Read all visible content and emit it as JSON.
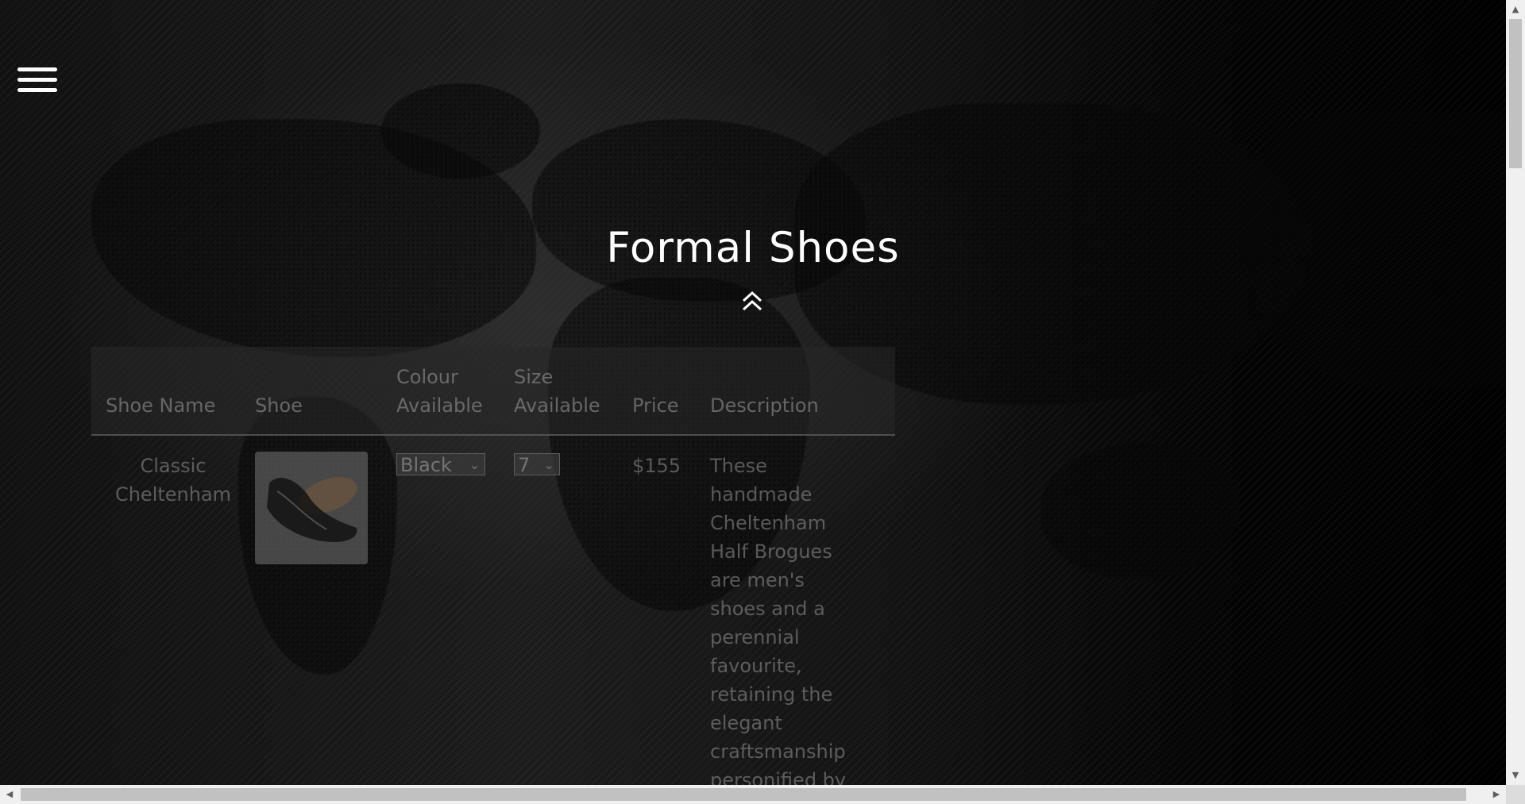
{
  "nav": {
    "menu_icon": "hamburger-menu-icon"
  },
  "header": {
    "title": "Formal Shoes",
    "scroll_up_icon": "double-chevron-up-icon"
  },
  "table": {
    "columns": [
      "Shoe Name",
      "Shoe",
      "Colour Available",
      "Size Available",
      "Price",
      "Description"
    ],
    "column_lines": {
      "colour": [
        "Colour",
        "Available"
      ],
      "size": [
        "Size",
        "Available"
      ]
    },
    "rows": [
      {
        "name_lines": [
          "Classic",
          "Cheltenham"
        ],
        "image_icon": "shoe-image",
        "colour_selected": "Black",
        "size_selected": "7",
        "price": "$155",
        "description_lines": [
          "These",
          "handmade",
          "Cheltenham",
          "Half Brogues",
          "are men's",
          "shoes and a",
          "perennial",
          "favourite,",
          "retaining the",
          "elegant",
          "craftsmanship",
          "personified by"
        ]
      }
    ]
  },
  "scrollbars": {
    "up_arrow": "▲",
    "down_arrow": "▼",
    "left_arrow": "◀",
    "right_arrow": "▶"
  }
}
